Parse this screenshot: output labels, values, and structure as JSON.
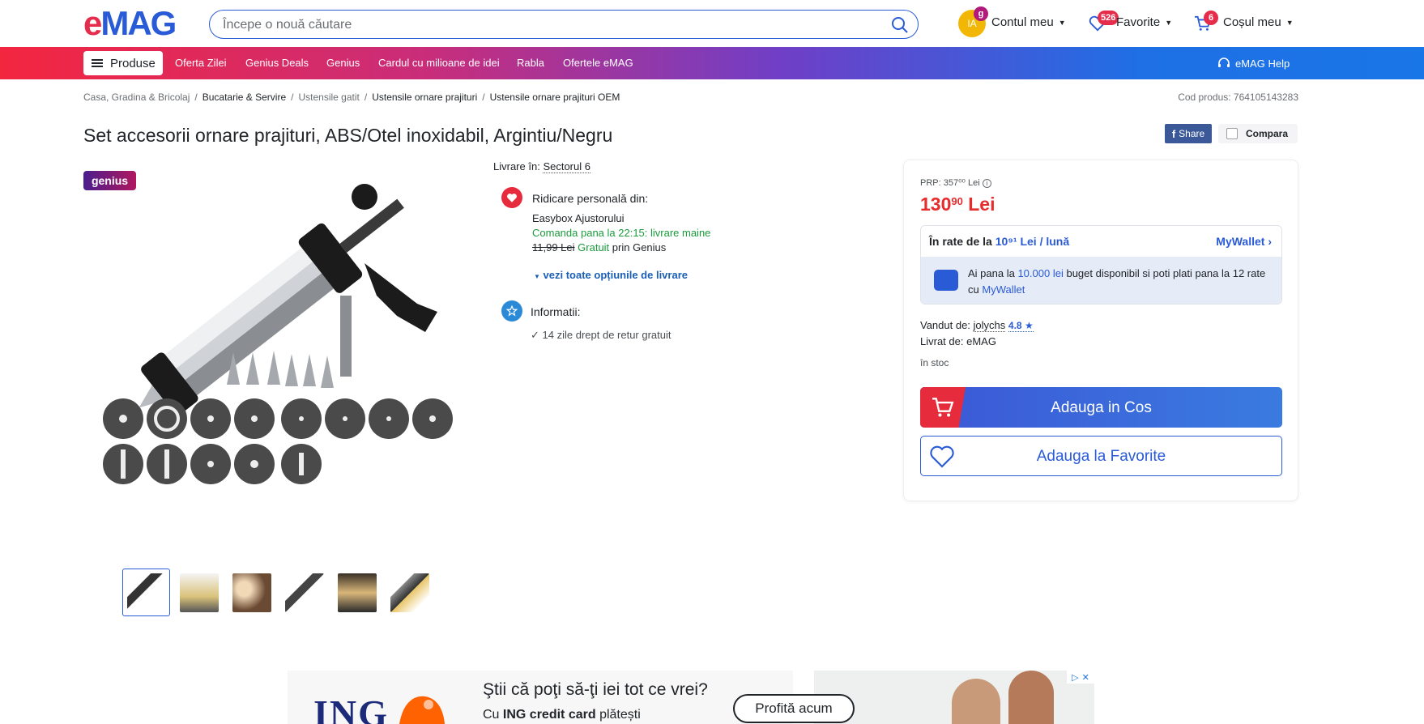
{
  "header": {
    "logo": "eMAG",
    "search_placeholder": "Începe o nouă căutare",
    "avatar_initials": "IA",
    "account_badge": "g",
    "account_label": "Contul meu",
    "favorites_badge": "526",
    "favorites_label": "Favorite",
    "cart_badge": "6",
    "cart_label": "Coșul meu"
  },
  "nav": {
    "produse": "Produse",
    "items": [
      "Oferta Zilei",
      "Genius Deals",
      "Genius",
      "Cardul cu milioane de idei",
      "Rabla",
      "Ofertele eMAG"
    ],
    "help": "eMAG Help"
  },
  "breadcrumb": [
    "Casa, Gradina & Bricolaj",
    "Bucatarie & Servire",
    "Ustensile gatit",
    "Ustensile ornare prajituri",
    "Ustensile ornare prajituri OEM"
  ],
  "product_code": "Cod produs: 764105143283",
  "title": "Set accesorii ornare prajituri, ABS/Otel inoxidabil, Argintiu/Negru",
  "share": {
    "facebook": "Share",
    "compare": "Compara"
  },
  "genius_badge": "genius",
  "thumbnails_count": 6,
  "delivery": {
    "livrare_label": "Livrare în:",
    "livrare_value": "Sectorul 6",
    "pickup_title": "Ridicare personală din:",
    "pickup_location": "Easybox Ajustorului",
    "pickup_order": "Comanda pana la 22:15: livrare maine",
    "pickup_old_price": "11,99 Lei",
    "pickup_free": "Gratuit",
    "pickup_via": "prin Genius",
    "all_options": "vezi toate opțiunile de livrare",
    "info_title": "Informatii:",
    "info_return": "14 zile drept de retur gratuit"
  },
  "buybox": {
    "prp": "PRP: 357⁰⁰ Lei",
    "price_int": "130",
    "price_dec": "90",
    "price_cur": "Lei",
    "rate_label": "În rate de la",
    "rate_value": "10⁹¹ Lei / lună",
    "mywallet": "MyWallet",
    "wallet_text_1": "Ai pana la",
    "wallet_amount": "10.000 lei",
    "wallet_text_2": "buget disponibil si poti plati pana la 12 rate cu",
    "wallet_link": "MyWallet",
    "sold_by_label": "Vandut de:",
    "sold_by": "jolychs",
    "rating": "4.8 ★",
    "delivered_by": "Livrat de: eMAG",
    "stock": "în stoc",
    "add_to_cart": "Adauga in Cos",
    "add_to_fav": "Adauga la Favorite"
  },
  "ad": {
    "brand": "ING",
    "headline": "Ştii că poţi să-ţi iei tot ce vrei?",
    "sub_1": "Cu",
    "sub_bold": "ING credit card",
    "sub_2": "plătești",
    "cta": "Profită acum"
  },
  "colors": {
    "primary": "#2a5bd7",
    "accent_red": "#e62c4b",
    "price_red": "#e62c2c",
    "green": "#1a9b3c"
  }
}
